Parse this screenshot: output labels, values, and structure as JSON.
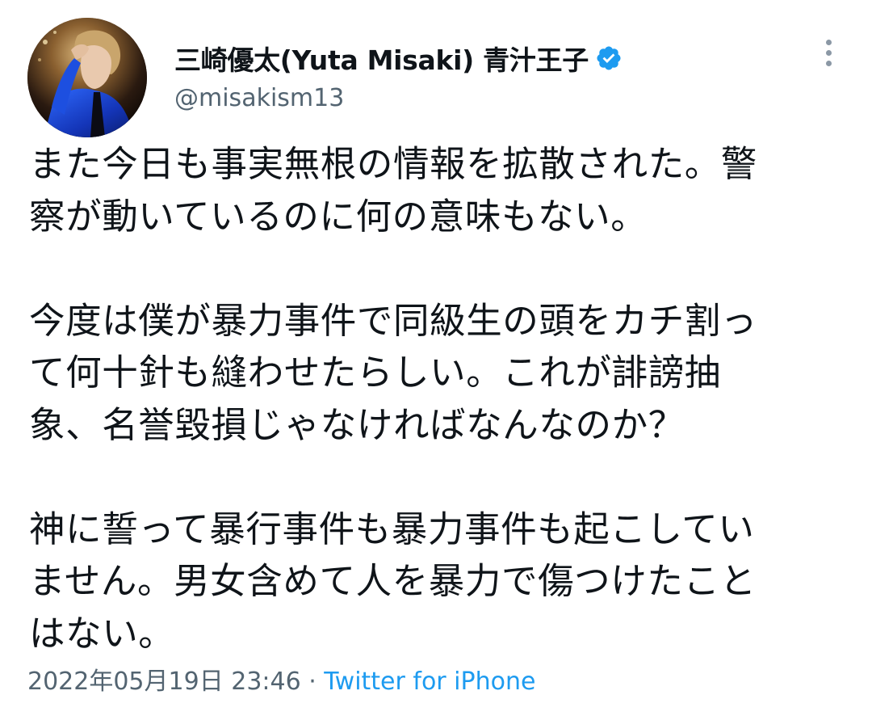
{
  "author": {
    "display_name": "三崎優太(Yuta Misaki) 青汁王子",
    "handle": "@misakism13",
    "verified_icon": "verified-badge-icon",
    "avatar": "profile-avatar"
  },
  "tweet": {
    "paragraphs": [
      [
        "また今日も事実無根の情報を拡散された。警",
        "察が動いているのに何の意味もない。"
      ],
      [
        "今度は僕が暴力事件で同級生の頭をカチ割っ",
        "て何十針も縫わせたらしい。これが誹謗抽",
        "象、名誉毀損じゃなければなんなのか？"
      ],
      [
        "神に誓って暴行事件も暴力事件も起こしてい",
        "ません。男女含めて人を暴力で傷つけたこと",
        "はない。"
      ]
    ]
  },
  "meta": {
    "timestamp": "2022年05月19日 23:46",
    "separator": " · ",
    "source": "Twitter for iPhone"
  },
  "colors": {
    "text_primary": "#0f1419",
    "text_secondary": "#536471",
    "link": "#1d9bf0",
    "verified": "#1d9bf0"
  },
  "icons": {
    "more": "more-options-icon"
  }
}
